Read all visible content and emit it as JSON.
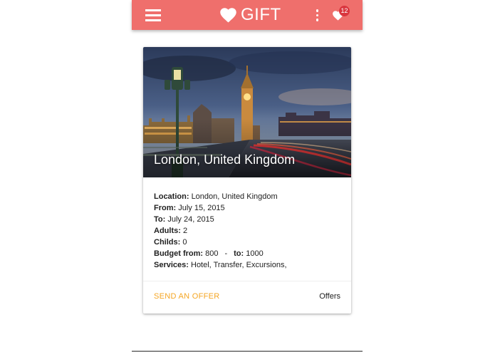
{
  "app": {
    "brand": "GIFT",
    "favorites_count": "12"
  },
  "card": {
    "hero_title": "London, United Kingdom",
    "fields": [
      {
        "label": "Location:",
        "value": "London, United Kingdom"
      },
      {
        "label": "From:",
        "value": "July 15, 2015"
      },
      {
        "label": "To:",
        "value": "July 24, 2015"
      },
      {
        "label": "Adults:",
        "value": "2"
      },
      {
        "label": "Childs:",
        "value": "0"
      }
    ],
    "budget": {
      "from_label": "Budget from:",
      "from_value": "800",
      "separator": "-",
      "to_label": "to:",
      "to_value": "1000"
    },
    "services": {
      "label": "Services:",
      "value": "Hotel, Transfer, Excursions,"
    },
    "actions": {
      "send_offer": "SEND AN OFFER",
      "offers": "Offers"
    }
  },
  "colors": {
    "appbar": "#ef6f6c",
    "badge": "#d9363e",
    "accent": "#f5a623"
  }
}
